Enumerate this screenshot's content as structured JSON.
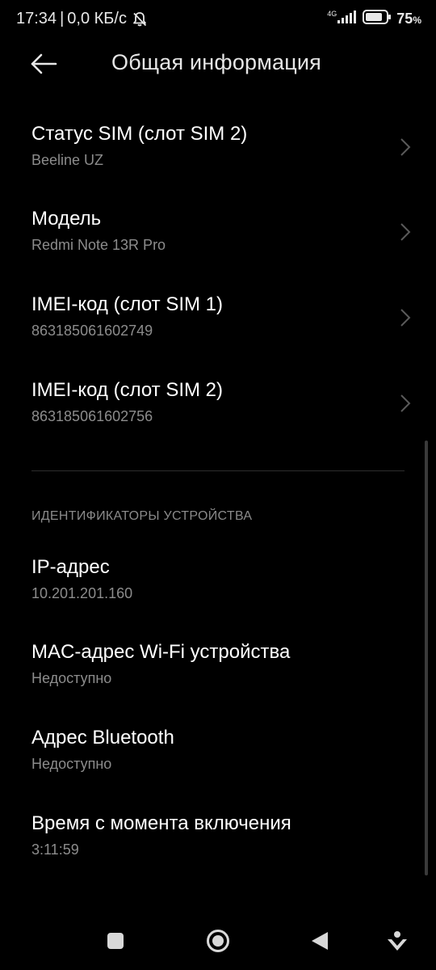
{
  "status_bar": {
    "time": "17:34",
    "separator": "|",
    "net_speed": "0,0 КБ/с",
    "network_type": "4G",
    "battery_level": "75",
    "battery_symbol": "%",
    "icons": [
      "bell-off-icon",
      "signal-icon",
      "battery-icon"
    ]
  },
  "header": {
    "title": "Общая информация",
    "back_icon": "arrow-left-icon"
  },
  "items": [
    {
      "title": "Статус SIM (слот SIM 2)",
      "subtitle": "Beeline UZ",
      "has_chevron": true
    },
    {
      "title": "Модель",
      "subtitle": "Redmi Note 13R Pro",
      "has_chevron": true
    },
    {
      "title": "IMEI-код (слот SIM 1)",
      "subtitle": "863185061602749",
      "has_chevron": true
    },
    {
      "title": "IMEI-код (слот SIM 2)",
      "subtitle": "863185061602756",
      "has_chevron": true
    }
  ],
  "section": {
    "header": "ИДЕНТИФИКАТОРЫ УСТРОЙСТВА",
    "items": [
      {
        "title": "IP-адрес",
        "subtitle": "10.201.201.160"
      },
      {
        "title": "MAC-адрес Wi-Fi устройства",
        "subtitle": "Недоступно"
      },
      {
        "title": "Адрес Bluetooth",
        "subtitle": "Недоступно"
      },
      {
        "title": "Время с момента включения",
        "subtitle": "3:11:59"
      }
    ]
  },
  "nav_bar": {
    "icons": [
      "recents-square-icon",
      "home-circle-icon",
      "back-triangle-icon",
      "assistant-icon"
    ]
  },
  "colors": {
    "background": "#000000",
    "title_text": "#ffffff",
    "subtitle_text": "#8c8c8c",
    "divider": "#2e2e2e"
  }
}
